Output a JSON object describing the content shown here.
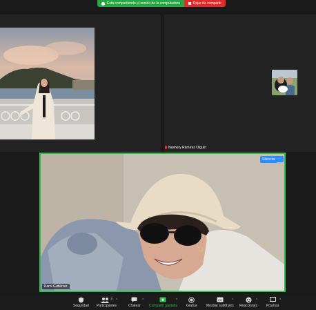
{
  "share_bar": {
    "status": "Está compartiendo el sonido de la computadora",
    "stop": "Dejar de compartir"
  },
  "participants": {
    "top_right": {
      "name": "Nashery Ramírez Olguín"
    },
    "active": {
      "name": "Karol Gutiérrez"
    }
  },
  "controls": {
    "silence": "Silenciar",
    "more": "···"
  },
  "toolbar": {
    "security": "Seguridad",
    "participants": "Participantes",
    "participants_count": "3",
    "chat": "Chatear",
    "share": "Compartir pantalla",
    "record": "Grabar",
    "captions": "Mostrar subtítulos",
    "reactions": "Reacciones",
    "whiteboards": "Pizarras"
  }
}
